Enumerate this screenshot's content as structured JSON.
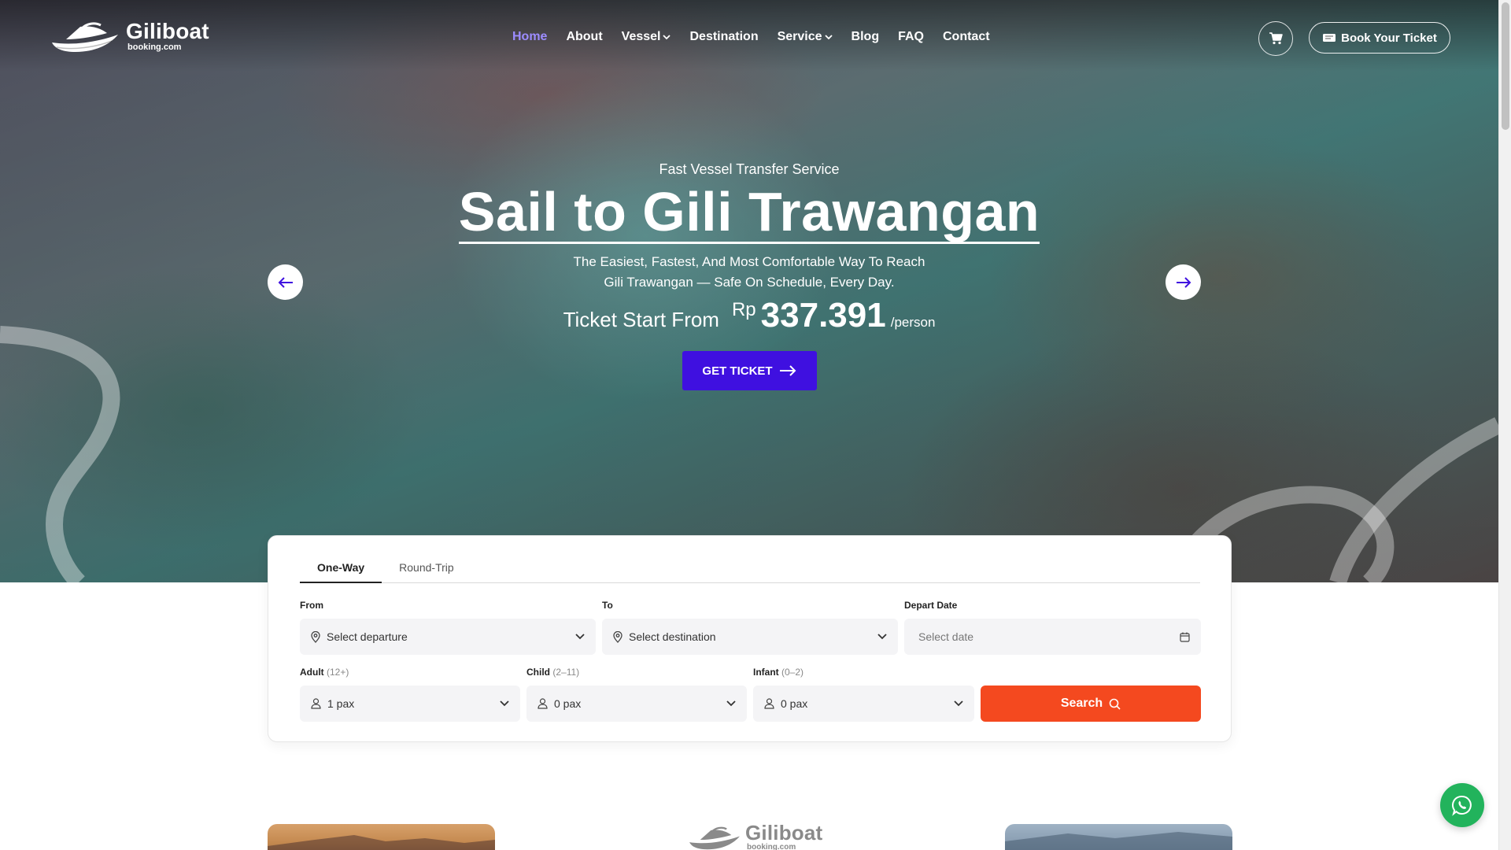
{
  "nav": {
    "logo_name": "Giliboat",
    "logo_sub": "booking.com",
    "items": [
      {
        "label": "Home",
        "active": true,
        "dropdown": false
      },
      {
        "label": "About",
        "active": false,
        "dropdown": false
      },
      {
        "label": "Vessel",
        "active": false,
        "dropdown": true
      },
      {
        "label": "Destination",
        "active": false,
        "dropdown": false
      },
      {
        "label": "Service",
        "active": false,
        "dropdown": true
      },
      {
        "label": "Blog",
        "active": false,
        "dropdown": false
      },
      {
        "label": "FAQ",
        "active": false,
        "dropdown": false
      },
      {
        "label": "Contact",
        "active": false,
        "dropdown": false
      }
    ],
    "book_label": "Book Your Ticket",
    "cart_icon": "cart-icon",
    "ticket_icon": "ticket-icon"
  },
  "hero": {
    "kicker": "Fast Vessel Transfer Service",
    "title": "Sail to Gili Trawangan",
    "desc_line1": "The Easiest, Fastest, And Most Comfortable Way To Reach",
    "desc_line2": "Gili Trawangan — Safe On Schedule, Every Day.",
    "price_label": "Ticket Start From",
    "price_currency": "Rp",
    "price_value": "337.391",
    "price_unit": "/person",
    "cta_label": "GET TICKET",
    "prev_icon": "arrow-left-icon",
    "next_icon": "arrow-right-icon"
  },
  "booking": {
    "tabs": [
      {
        "label": "One-Way",
        "active": true
      },
      {
        "label": "Round-Trip",
        "active": false
      }
    ],
    "from_label": "From",
    "from_value": "Select departure",
    "to_label": "To",
    "to_value": "Select destination",
    "date_label": "Depart Date",
    "date_placeholder": "Select date",
    "adult_label": "Adult",
    "adult_range": "(12+)",
    "adult_value": "1 pax",
    "child_label": "Child",
    "child_range": "(2–11)",
    "child_value": "0 pax",
    "infant_label": "Infant",
    "infant_range": "(0–2)",
    "infant_value": "0 pax",
    "search_label": "Search"
  },
  "colors": {
    "accent": "#3f10e0",
    "active_nav": "#9c8cff",
    "search": "#f4491f",
    "whatsapp": "#22b35c"
  }
}
